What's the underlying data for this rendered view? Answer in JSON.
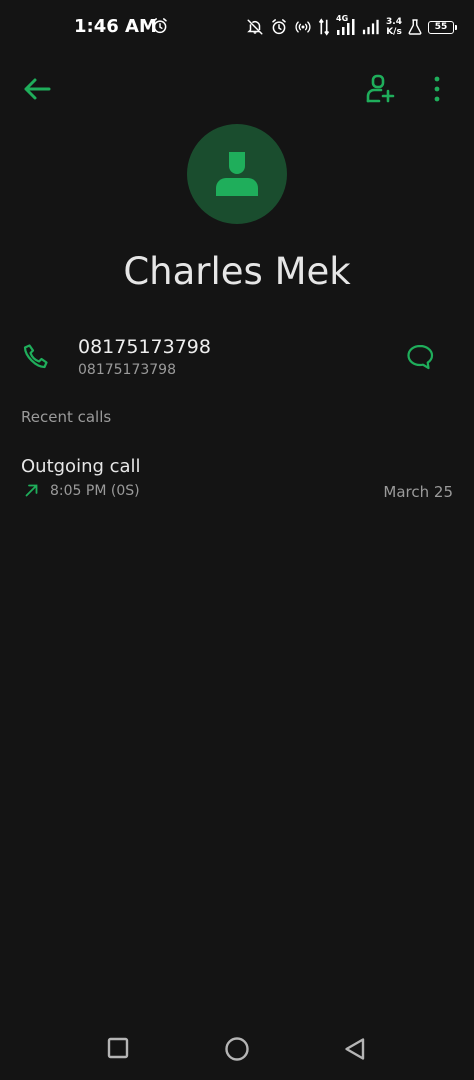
{
  "status_bar": {
    "time": "1:46 AM",
    "network_type": "4G",
    "speed_value": "3.4",
    "speed_unit": "K/s",
    "battery": "55"
  },
  "header": {
    "back_icon": "arrow-left-icon",
    "add_contact_icon": "person-add-icon",
    "more_icon": "more-vert-icon"
  },
  "contact": {
    "name": "Charles Mek",
    "avatar_icon": "person-icon",
    "phone_number": "08175173798",
    "phone_subtext": "08175173798"
  },
  "recent_calls": {
    "title": "Recent calls",
    "items": [
      {
        "type": "Outgoing call",
        "time": "8:05 PM (0S)",
        "date": "March 25",
        "icon": "outgoing-arrow-icon"
      }
    ]
  },
  "colors": {
    "accent": "#1fae5b",
    "background": "#141414",
    "avatar_bg": "#1a4d2e",
    "secondary_text": "#9a9a9a"
  }
}
